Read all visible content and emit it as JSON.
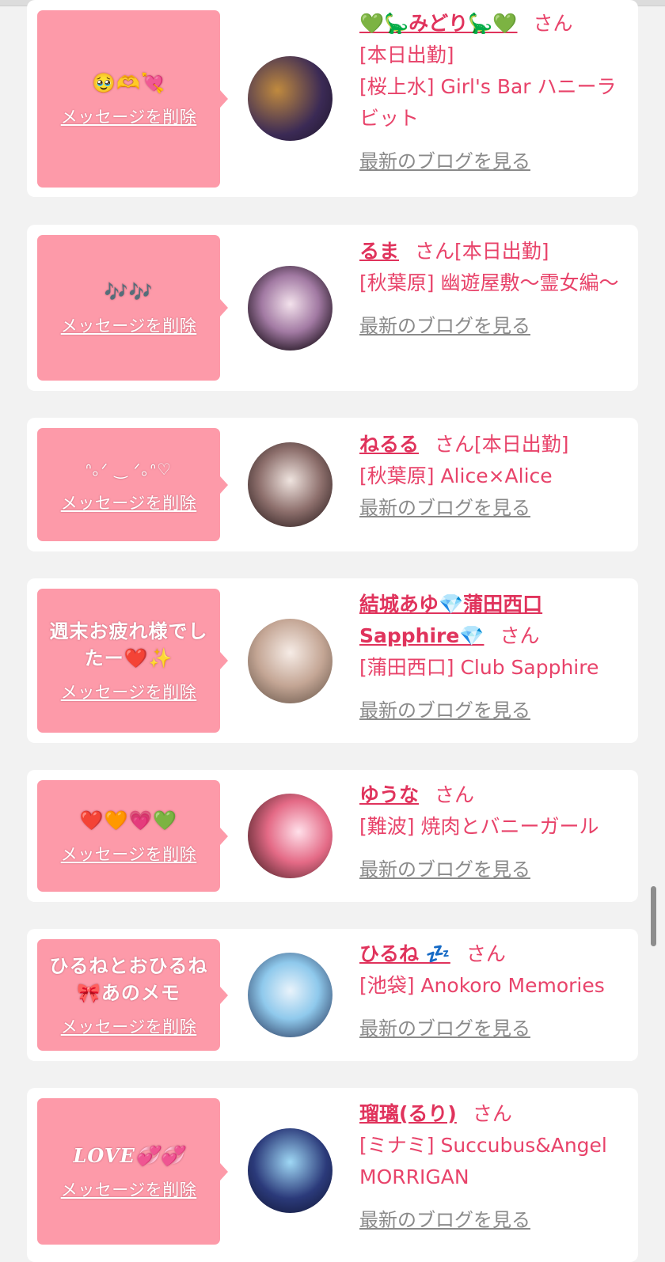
{
  "common": {
    "delete_label": "メッセージを削除",
    "blog_label": "最新のブログを見る",
    "san": "さん"
  },
  "items": [
    {
      "message": "🥹🫶💘",
      "name": "💚🦕みどり🦕💚",
      "line1": "[本日出勤]",
      "line2": "[桜上水] Girl's Bar ハニーラビット"
    },
    {
      "message": "🎶🎶",
      "name": "るま",
      "line1": "[本日出勤]",
      "line2": "[秋葉原] 幽遊屋敷〜霊女編〜"
    },
    {
      "message": "ᐢ｡ᐟ ‿ ᐟ｡ᐢ♡",
      "name": "ねるる",
      "line1": "[本日出勤]",
      "line2": "[秋葉原] Alice×Alice"
    },
    {
      "message": "週末お疲れ様でしたー❤️✨",
      "name": "結城あゆ💎蒲田西口Sapphire💎",
      "line1": "",
      "line2": "[蒲田西口] Club Sapphire"
    },
    {
      "message": "❤️🧡💗💚",
      "name": "ゆうな",
      "line1": "",
      "line2": "[難波] 焼肉とバニーガール"
    },
    {
      "message": "ひるねとおひるね🎀あのメモ",
      "name": "ひるね 💤",
      "line1": "",
      "line2": "[池袋] Anokoro Memories"
    },
    {
      "message": "LOVE💞💞",
      "name": "瑠璃(るり)",
      "line1": "",
      "line2": "[ミナミ] Succubus&Angel MORRIGAN"
    }
  ],
  "avatars": [
    {
      "kind": "photo",
      "colors": [
        "#2a1f3d",
        "#b8823a",
        "#5a3b6e"
      ]
    },
    {
      "kind": "photo",
      "colors": [
        "#f0d8e8",
        "#2b1c2a",
        "#b07fb0"
      ]
    },
    {
      "kind": "photo",
      "colors": [
        "#e8dcd6",
        "#6a4a4a",
        "#b9a39d"
      ]
    },
    {
      "kind": "photo",
      "colors": [
        "#f2e8e2",
        "#b59a8a",
        "#7ec8e3"
      ]
    },
    {
      "kind": "photo",
      "colors": [
        "#e46a86",
        "#7a3a3e",
        "#ffd6e0"
      ]
    },
    {
      "kind": "photo",
      "colors": [
        "#8fc9ec",
        "#2c3e63",
        "#e9f3fb"
      ]
    },
    {
      "kind": "photo",
      "colors": [
        "#2b3a7a",
        "#6ec5f2",
        "#141b3e"
      ]
    }
  ]
}
